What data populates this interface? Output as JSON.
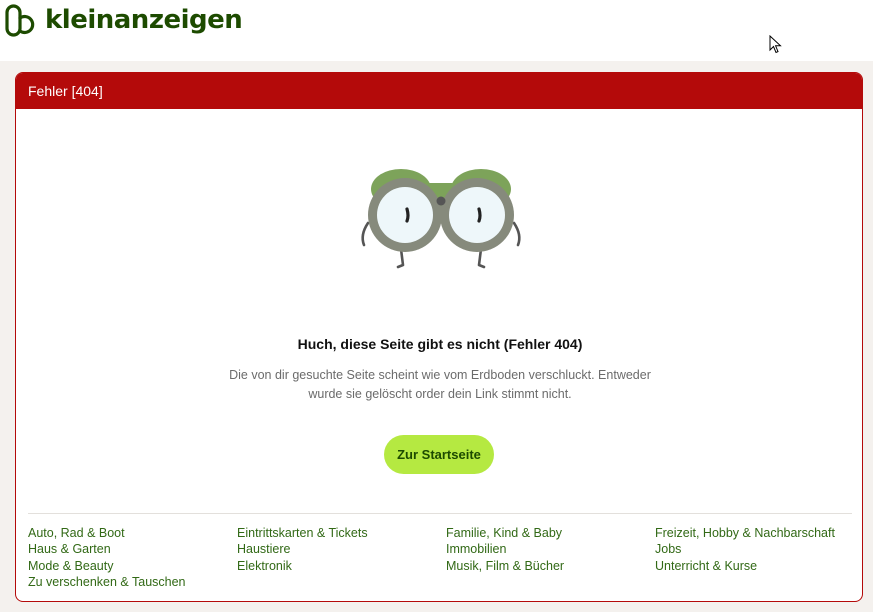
{
  "header": {
    "logo_text": "kleinanzeigen"
  },
  "card": {
    "title": "Fehler [404]",
    "heading": "Huch, diese Seite gibt es nicht (Fehler 404)",
    "description": "Die von dir gesuchte Seite scheint wie vom Erdboden verschluckt. Entweder wurde sie gelöscht order dein Link stimmt nicht.",
    "button_label": "Zur Startseite"
  },
  "categories": {
    "col1": [
      "Auto, Rad & Boot",
      "Haus & Garten",
      "Mode & Beauty",
      "Zu verschenken & Tauschen"
    ],
    "col2": [
      "Eintrittskarten & Tickets",
      "Haustiere",
      "Elektronik"
    ],
    "col3": [
      "Familie, Kind & Baby",
      "Immobilien",
      "Musik, Film & Bücher"
    ],
    "col4": [
      "Freizeit, Hobby & Nachbarschaft",
      "Jobs",
      "Unterricht & Kurse"
    ]
  },
  "colors": {
    "brand_green": "#1d4b00",
    "error_red": "#b40a0a",
    "button_lime": "#b5e941",
    "link_green": "#326916"
  },
  "icons": {
    "logo": "kleinanzeigen-logo-icon",
    "illustration": "binoculars-illustration",
    "cursor": "mouse-pointer-icon"
  }
}
